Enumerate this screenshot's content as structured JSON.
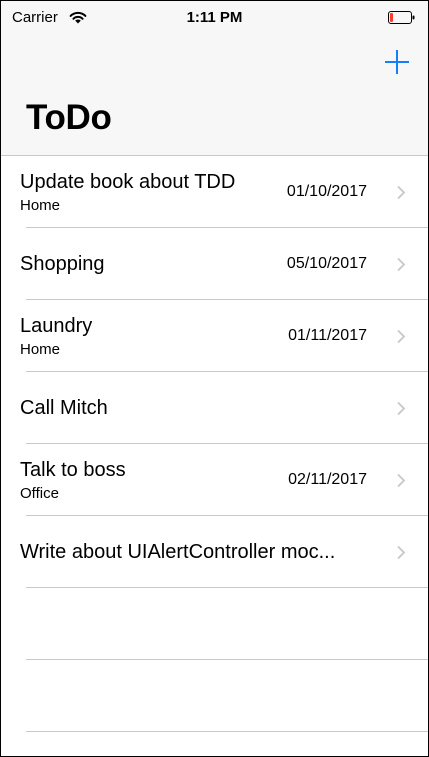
{
  "status_bar": {
    "carrier": "Carrier",
    "time": "1:11 PM"
  },
  "nav": {
    "title": "ToDo",
    "add_icon": "plus-icon"
  },
  "colors": {
    "accent": "#147efb",
    "battery": "#ff3b30",
    "separator": "#c8c7cc",
    "chevron": "#c7c7cc"
  },
  "items": [
    {
      "title": "Update book about TDD",
      "location": "Home",
      "date": "01/10/2017"
    },
    {
      "title": "Shopping",
      "location": "",
      "date": "05/10/2017"
    },
    {
      "title": "Laundry",
      "location": "Home",
      "date": "01/11/2017"
    },
    {
      "title": "Call Mitch",
      "location": "",
      "date": ""
    },
    {
      "title": "Talk to boss",
      "location": "Office",
      "date": "02/11/2017"
    },
    {
      "title": "Write about UIAlertController moc...",
      "location": "",
      "date": ""
    }
  ]
}
